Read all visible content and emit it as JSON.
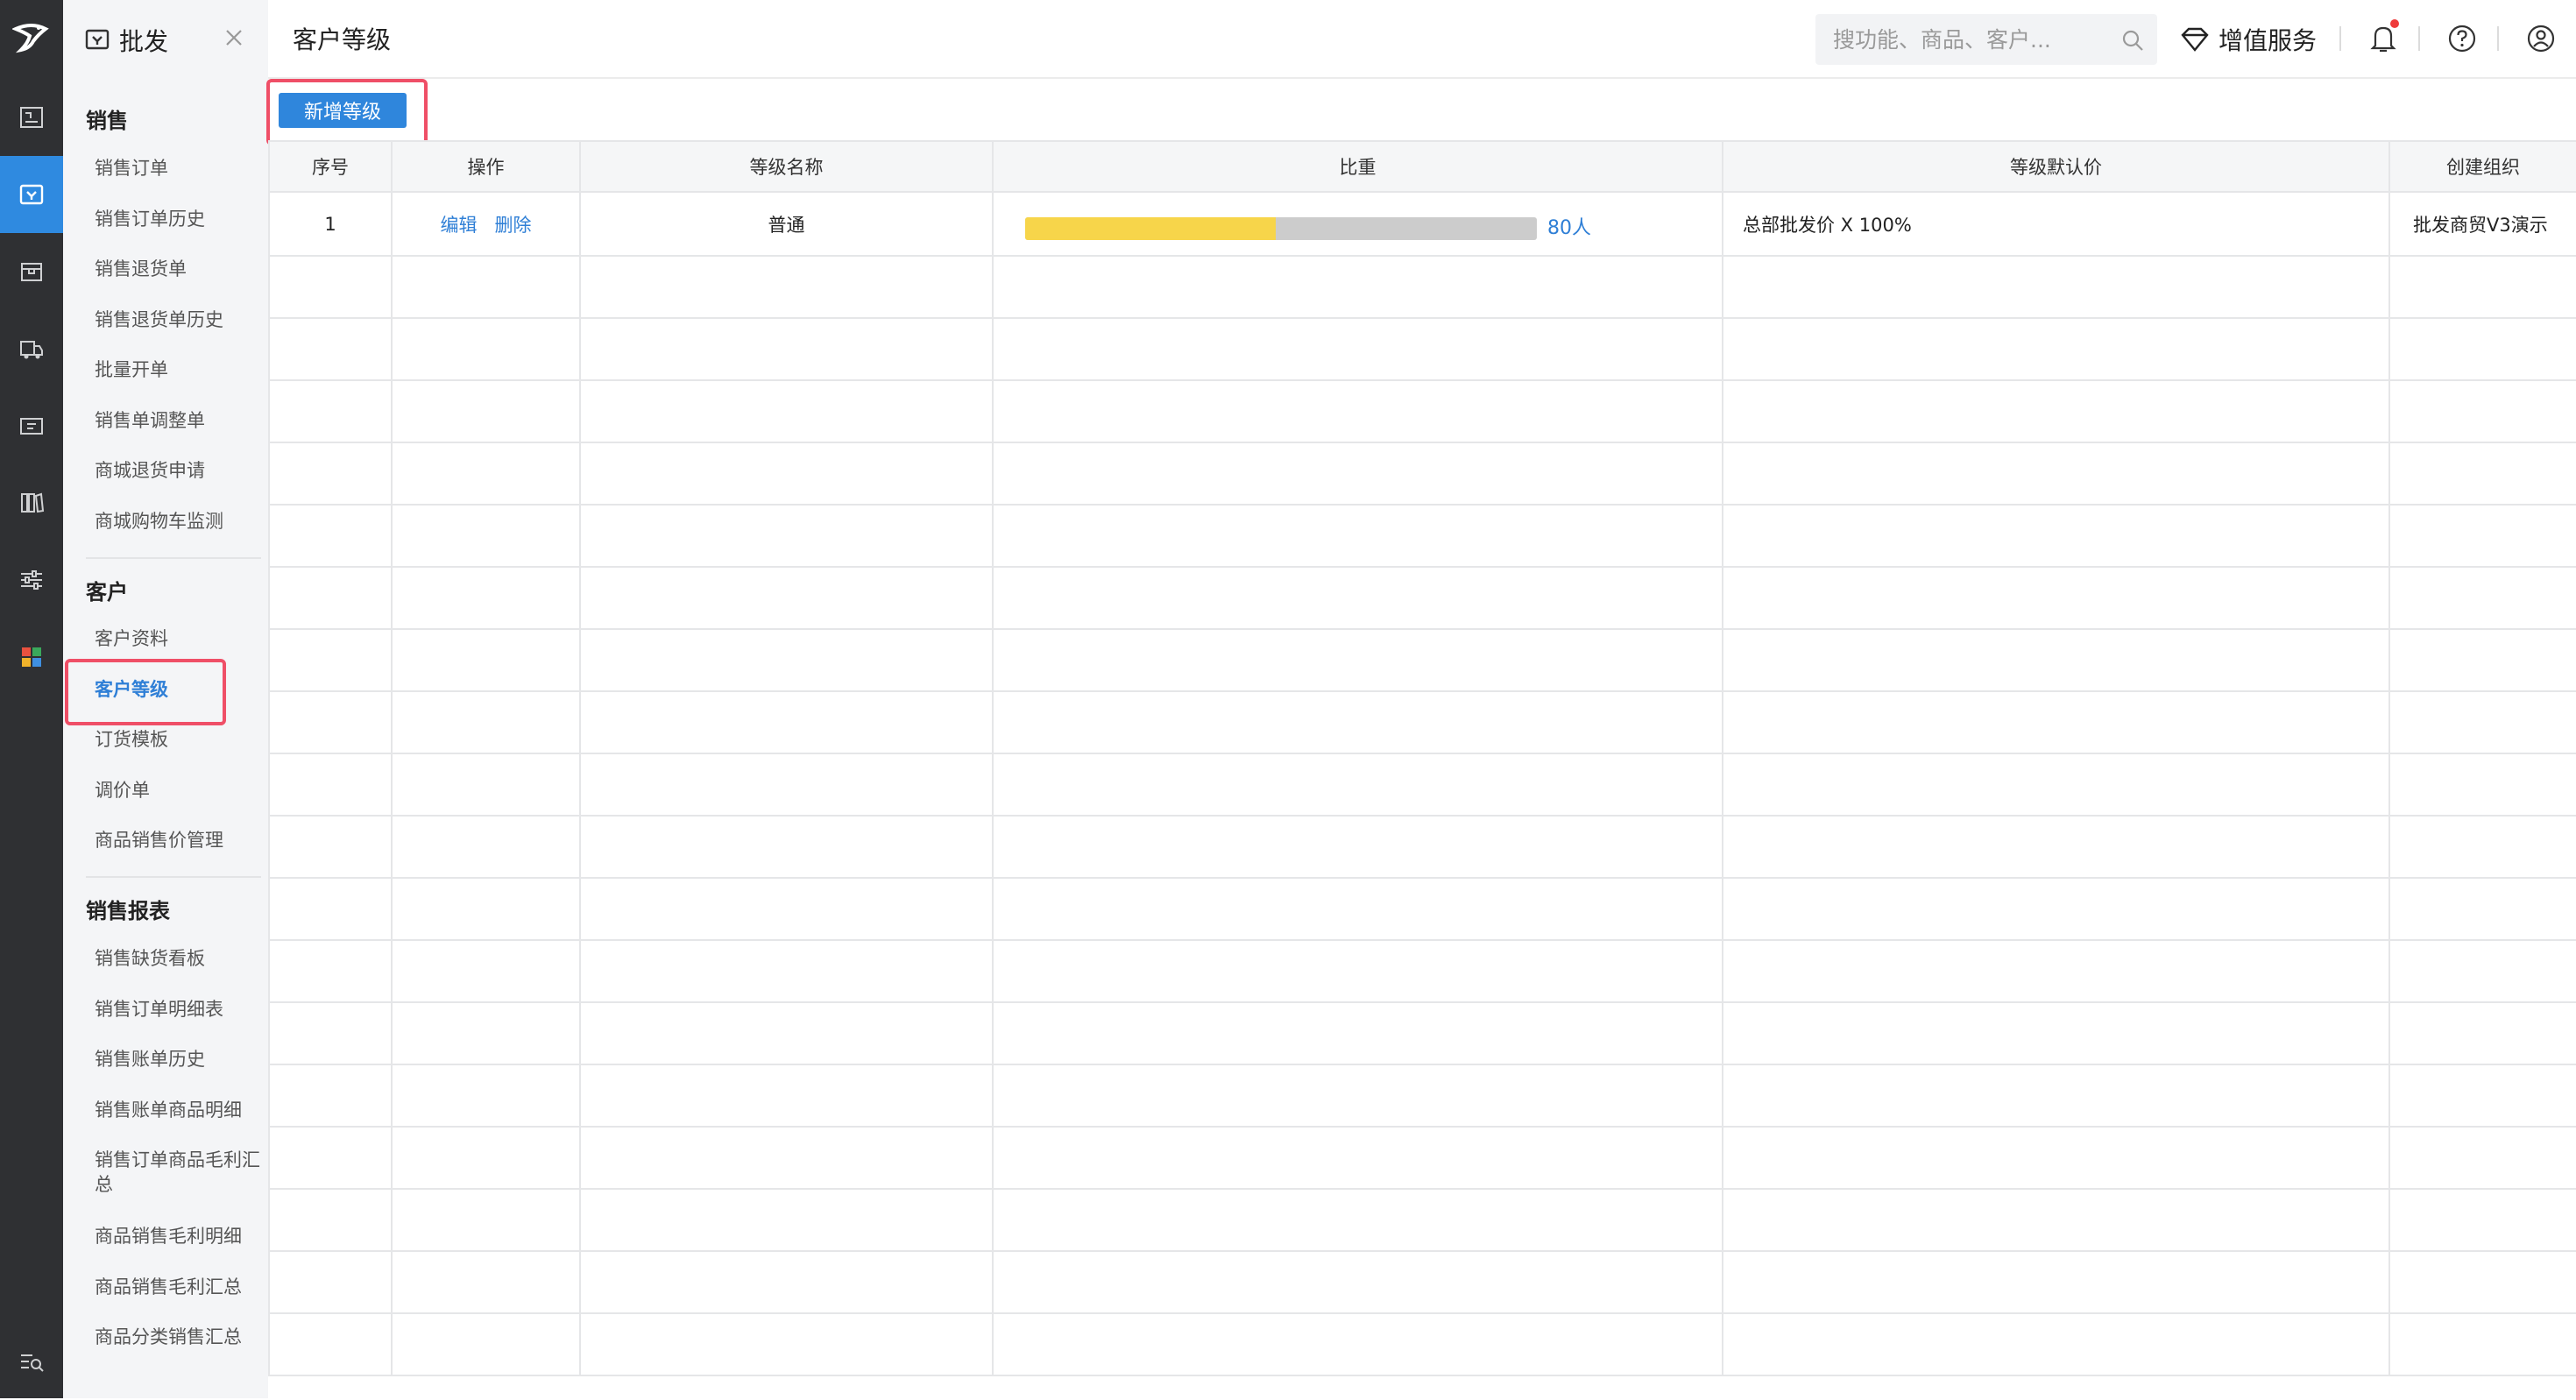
{
  "app": {
    "module_title": "批发",
    "page_title": "客户等级"
  },
  "rail": {
    "items": [
      "logo-icon",
      "board-icon",
      "wholesale-icon",
      "box-icon",
      "truck-icon",
      "ticket-icon",
      "library-icon",
      "sliders-icon",
      "apps-icon"
    ],
    "active": "wholesale-icon",
    "bottom": "search-list-icon"
  },
  "menu": {
    "groups": [
      {
        "title": "销售",
        "items": [
          "销售订单",
          "销售订单历史",
          "销售退货单",
          "销售退货单历史",
          "批量开单",
          "销售单调整单",
          "商城退货申请",
          "商城购物车监测"
        ]
      },
      {
        "title": "客户",
        "items": [
          "客户资料",
          "客户等级",
          "订货模板",
          "调价单",
          "商品销售价管理"
        ]
      },
      {
        "title": "销售报表",
        "items": [
          "销售缺货看板",
          "销售订单明细表",
          "销售账单历史",
          "销售账单商品明细",
          "销售订单商品毛利汇总",
          "商品销售毛利明细",
          "商品销售毛利汇总",
          "商品分类销售汇总"
        ]
      }
    ],
    "active_item": "客户等级"
  },
  "header": {
    "search_placeholder": "搜功能、商品、客户...",
    "value_added": "增值服务",
    "notification_dot_color": "#ef3b3b"
  },
  "toolbar": {
    "add_level_label": "新增等级"
  },
  "table": {
    "columns": [
      "序号",
      "操作",
      "等级名称",
      "比重",
      "等级默认价",
      "创建组织"
    ],
    "rows": [
      {
        "index": "1",
        "edit": "编辑",
        "delete": "删除",
        "name": "普通",
        "ratio_fraction": 0.49,
        "ratio_count": "80人",
        "default_price": "总部批发价 X 100%",
        "org": "批发商贸V3演示"
      }
    ],
    "empty_rows": 18
  },
  "colors": {
    "accent": "#2f86dc",
    "bar_fill": "#f7d54a",
    "bar_track": "#cccccc",
    "highlight": "#ef4f67",
    "rail_bg": "#2f3033"
  }
}
